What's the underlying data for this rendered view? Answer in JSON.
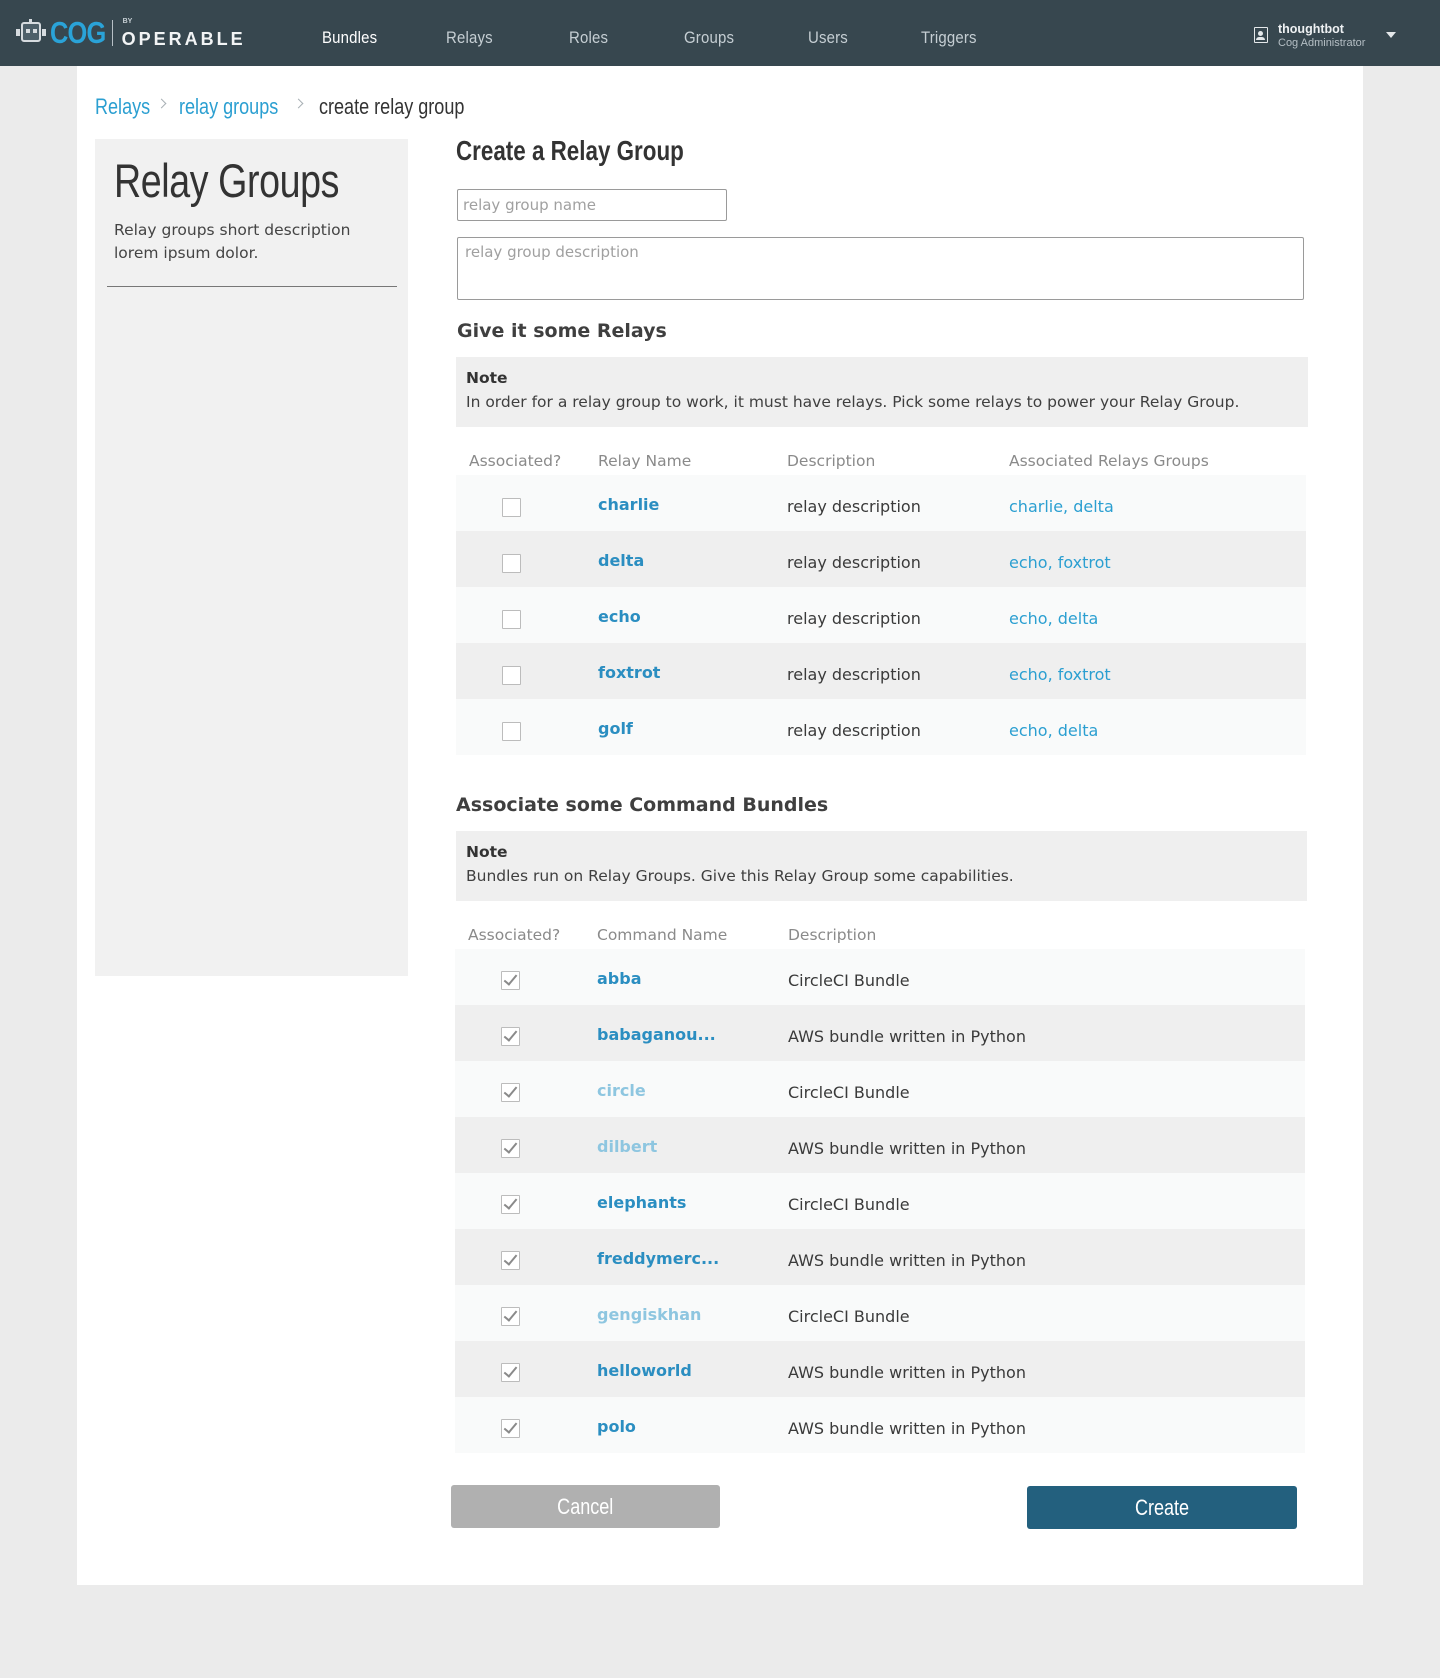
{
  "brand": {
    "name": "COG",
    "by": "BY",
    "company": "OPERABLE"
  },
  "nav": [
    {
      "label": "Bundles",
      "active": true
    },
    {
      "label": "Relays",
      "active": false
    },
    {
      "label": "Roles",
      "active": false
    },
    {
      "label": "Groups",
      "active": false
    },
    {
      "label": "Users",
      "active": false
    },
    {
      "label": "Triggers",
      "active": false
    }
  ],
  "user": {
    "name": "thoughtbot",
    "role": "Cog Administrator"
  },
  "breadcrumb": [
    {
      "label": "Relays"
    },
    {
      "label": "relay groups"
    },
    {
      "label": "create relay group"
    }
  ],
  "sidebar": {
    "title": "Relay Groups",
    "description": "Relay groups short description lorem ipsum dolor."
  },
  "form": {
    "title": "Create a Relay Group",
    "name_placeholder": "relay group name",
    "description_placeholder": "relay group description"
  },
  "relays_section": {
    "title": "Give it some Relays",
    "note_head": "Note",
    "note_body": "In order for a relay group to work, it must have relays. Pick some relays to power your Relay Group.",
    "columns": [
      "Associated?",
      "Relay Name",
      "Description",
      "Associated Relays Groups"
    ],
    "rows": [
      {
        "name": "charlie",
        "description": "relay description",
        "groups": "charlie, delta",
        "checked": false
      },
      {
        "name": "delta",
        "description": "relay description",
        "groups": "echo, foxtrot",
        "checked": false
      },
      {
        "name": "echo",
        "description": "relay description",
        "groups": "echo, delta",
        "checked": false
      },
      {
        "name": "foxtrot",
        "description": "relay description",
        "groups": "echo, foxtrot",
        "checked": false
      },
      {
        "name": "golf",
        "description": "relay description",
        "groups": "echo, delta",
        "checked": false
      }
    ]
  },
  "bundles_section": {
    "title": "Associate some Command Bundles",
    "note_head": "Note",
    "note_body": "Bundles run on Relay Groups. Give this Relay Group some capabilities.",
    "columns": [
      "Associated?",
      "Command Name",
      "Description"
    ],
    "rows": [
      {
        "name": "abba",
        "description": "CircleCI Bundle",
        "checked": true,
        "dim": false
      },
      {
        "name": "babaganou...",
        "description": "AWS bundle written in Python",
        "checked": true,
        "dim": false
      },
      {
        "name": "circle",
        "description": "CircleCI Bundle",
        "checked": true,
        "dim": true
      },
      {
        "name": "dilbert",
        "description": "AWS bundle written in Python",
        "checked": true,
        "dim": true
      },
      {
        "name": "elephants",
        "description": "CircleCI Bundle",
        "checked": true,
        "dim": false
      },
      {
        "name": "freddymerc...",
        "description": "AWS bundle written in Python",
        "checked": true,
        "dim": false
      },
      {
        "name": "gengiskhan",
        "description": "CircleCI Bundle",
        "checked": true,
        "dim": true
      },
      {
        "name": "helloworld",
        "description": "AWS bundle written in Python",
        "checked": true,
        "dim": false
      },
      {
        "name": "polo",
        "description": "AWS bundle written in Python",
        "checked": true,
        "dim": false
      }
    ]
  },
  "actions": {
    "cancel": "Cancel",
    "create": "Create"
  },
  "colors": {
    "nav_bg": "#37474f",
    "brand_blue": "#2aa3d8",
    "link": "#2b8ec1",
    "create_button": "#23607e",
    "cancel_button": "#b0b0b0"
  }
}
